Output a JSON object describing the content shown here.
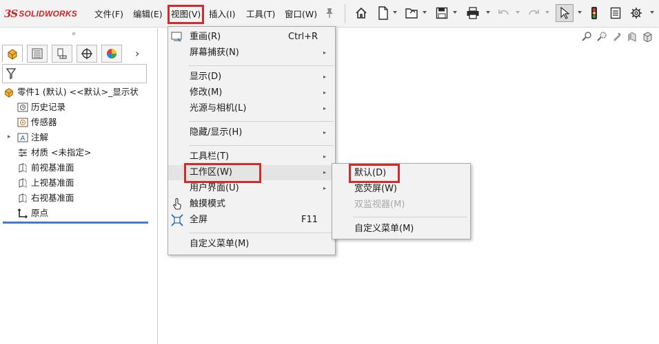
{
  "app": {
    "logo_ds": "3S",
    "logo_name": "SOLIDWORKS",
    "brand_color": "#d2232a",
    "highlight_color": "#d22b2b"
  },
  "menubar": {
    "items": [
      {
        "label": "文件(F)"
      },
      {
        "label": "编辑(E)"
      },
      {
        "label": "视图(V)",
        "selected": true
      },
      {
        "label": "插入(I)"
      },
      {
        "label": "工具(T)"
      },
      {
        "label": "窗口(W)"
      }
    ],
    "pin_icon": "pin-icon"
  },
  "toolbar": {
    "icons": [
      "home-icon",
      "new-document-icon",
      "open-folder-icon",
      "save-icon",
      "print-icon",
      "undo-icon",
      "redo-icon",
      "select-arrow-icon",
      "traffic-light-icon",
      "file-properties-icon",
      "options-gear-icon"
    ]
  },
  "panel": {
    "tabs": [
      "feature-manager-tab",
      "property-manager-tab",
      "configuration-manager-tab",
      "dimxpert-tab",
      "display-manager-tab"
    ],
    "more_label": "›",
    "filter_icon": "filter-icon",
    "tree": [
      {
        "label": "零件1 (默认) <<默认>_显示状",
        "icon": "part-icon"
      },
      {
        "label": "历史记录",
        "icon": "history-icon"
      },
      {
        "label": "传感器",
        "icon": "sensor-icon"
      },
      {
        "label": "注解",
        "icon": "annotation-icon",
        "expandable": true
      },
      {
        "label": "材质 <未指定>",
        "icon": "material-icon"
      },
      {
        "label": "前视基准面",
        "icon": "plane-icon"
      },
      {
        "label": "上视基准面",
        "icon": "plane-icon"
      },
      {
        "label": "右视基准面",
        "icon": "plane-icon"
      },
      {
        "label": "原点",
        "icon": "origin-icon"
      }
    ]
  },
  "view_menu": {
    "items": [
      {
        "label": "重画(R)",
        "shortcut": "Ctrl+R",
        "icon": "redraw-icon"
      },
      {
        "label": "屏幕捕获(N)",
        "submenu": true
      },
      {
        "label": "显示(D)",
        "submenu": true
      },
      {
        "label": "修改(M)",
        "submenu": true
      },
      {
        "label": "光源与相机(L)",
        "submenu": true
      },
      {
        "label": "隐藏/显示(H)",
        "submenu": true
      },
      {
        "label": "工具栏(T)",
        "submenu": true
      },
      {
        "label": "工作区(W)",
        "submenu": true,
        "highlighted": true
      },
      {
        "label": "用户界面(U)",
        "submenu": true
      },
      {
        "label": "触摸模式",
        "icon": "touch-icon"
      },
      {
        "label": "全屏",
        "shortcut": "F11",
        "icon": "fullscreen-icon"
      },
      {
        "label": "自定义菜单(M)"
      }
    ]
  },
  "workarea_submenu": {
    "items": [
      {
        "label": "默认(D)",
        "boxed": true
      },
      {
        "label": "宽荧屏(W)"
      },
      {
        "label": "双监视器(M)",
        "disabled": true
      },
      {
        "label": "自定义菜单(M)"
      }
    ]
  }
}
